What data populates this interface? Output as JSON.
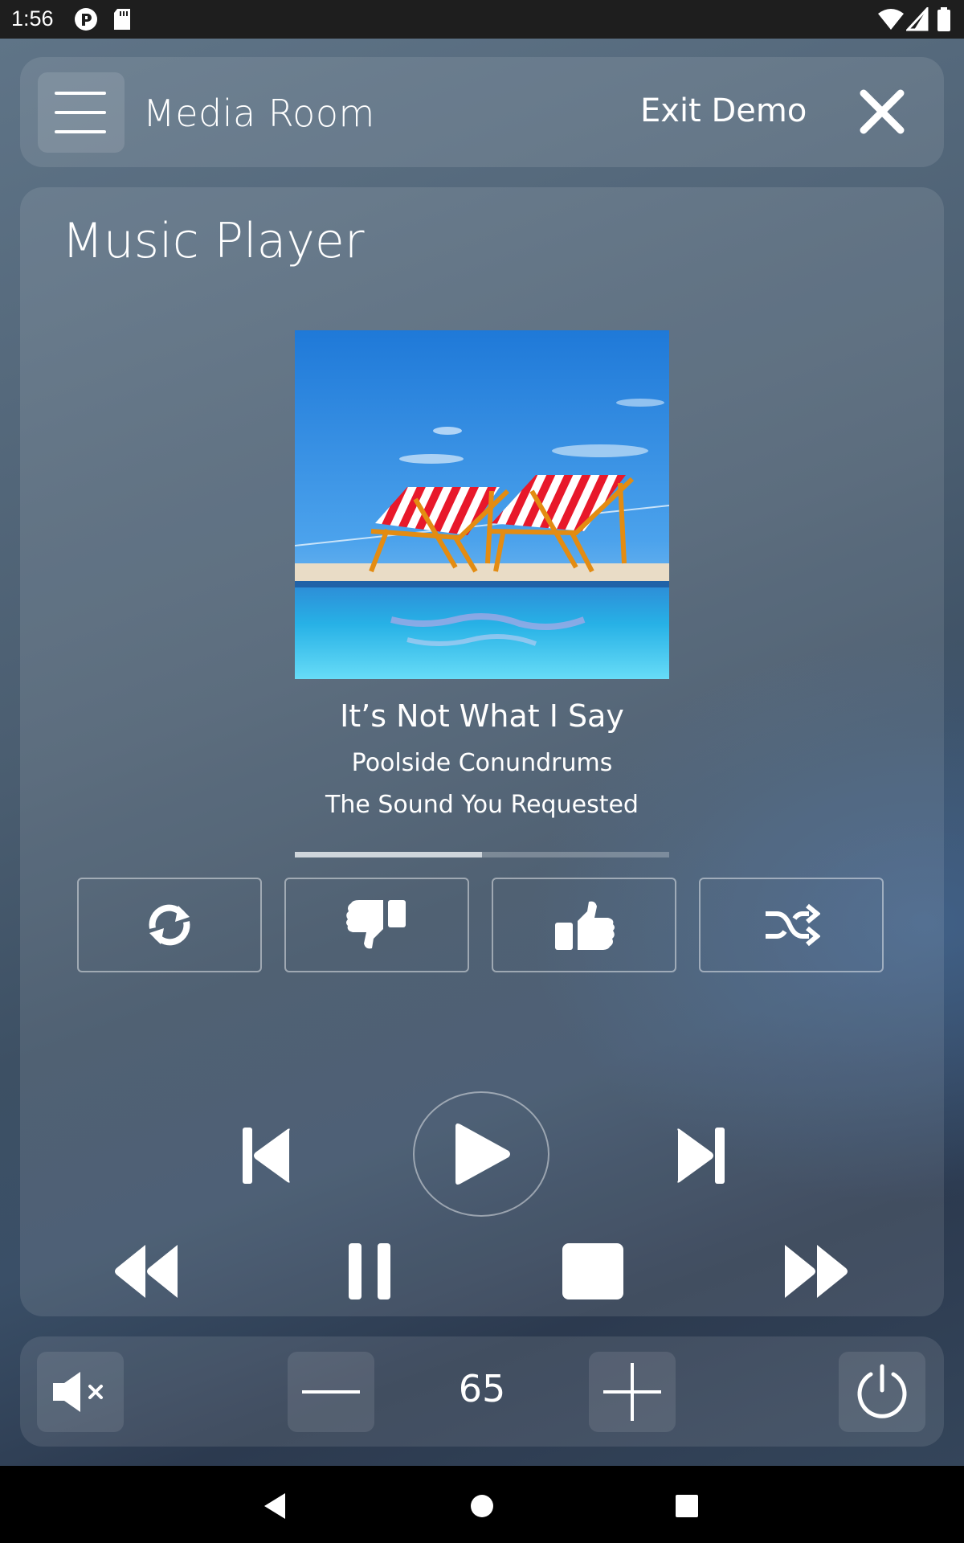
{
  "status_bar": {
    "time": "1:56"
  },
  "header": {
    "room_name": "Media Room",
    "exit_label": "Exit Demo"
  },
  "player": {
    "title": "Music Player",
    "track": {
      "title": "It’s Not What I Say",
      "artist": "Poolside Conundrums",
      "source": "The Sound You Requested"
    },
    "progress_fraction": 0.5,
    "option_buttons": [
      "repeat-icon",
      "thumbs-down-icon",
      "thumbs-up-icon",
      "shuffle-icon"
    ],
    "transport": [
      "skip-previous-icon",
      "play-icon",
      "skip-next-icon",
      "rewind-icon",
      "pause-icon",
      "stop-icon",
      "fast-forward-icon"
    ]
  },
  "volume": {
    "level": "65"
  },
  "colors": {
    "panel": "rgba(255,255,255,0.10)",
    "text": "#ffffff",
    "background": "#4a5d70"
  }
}
